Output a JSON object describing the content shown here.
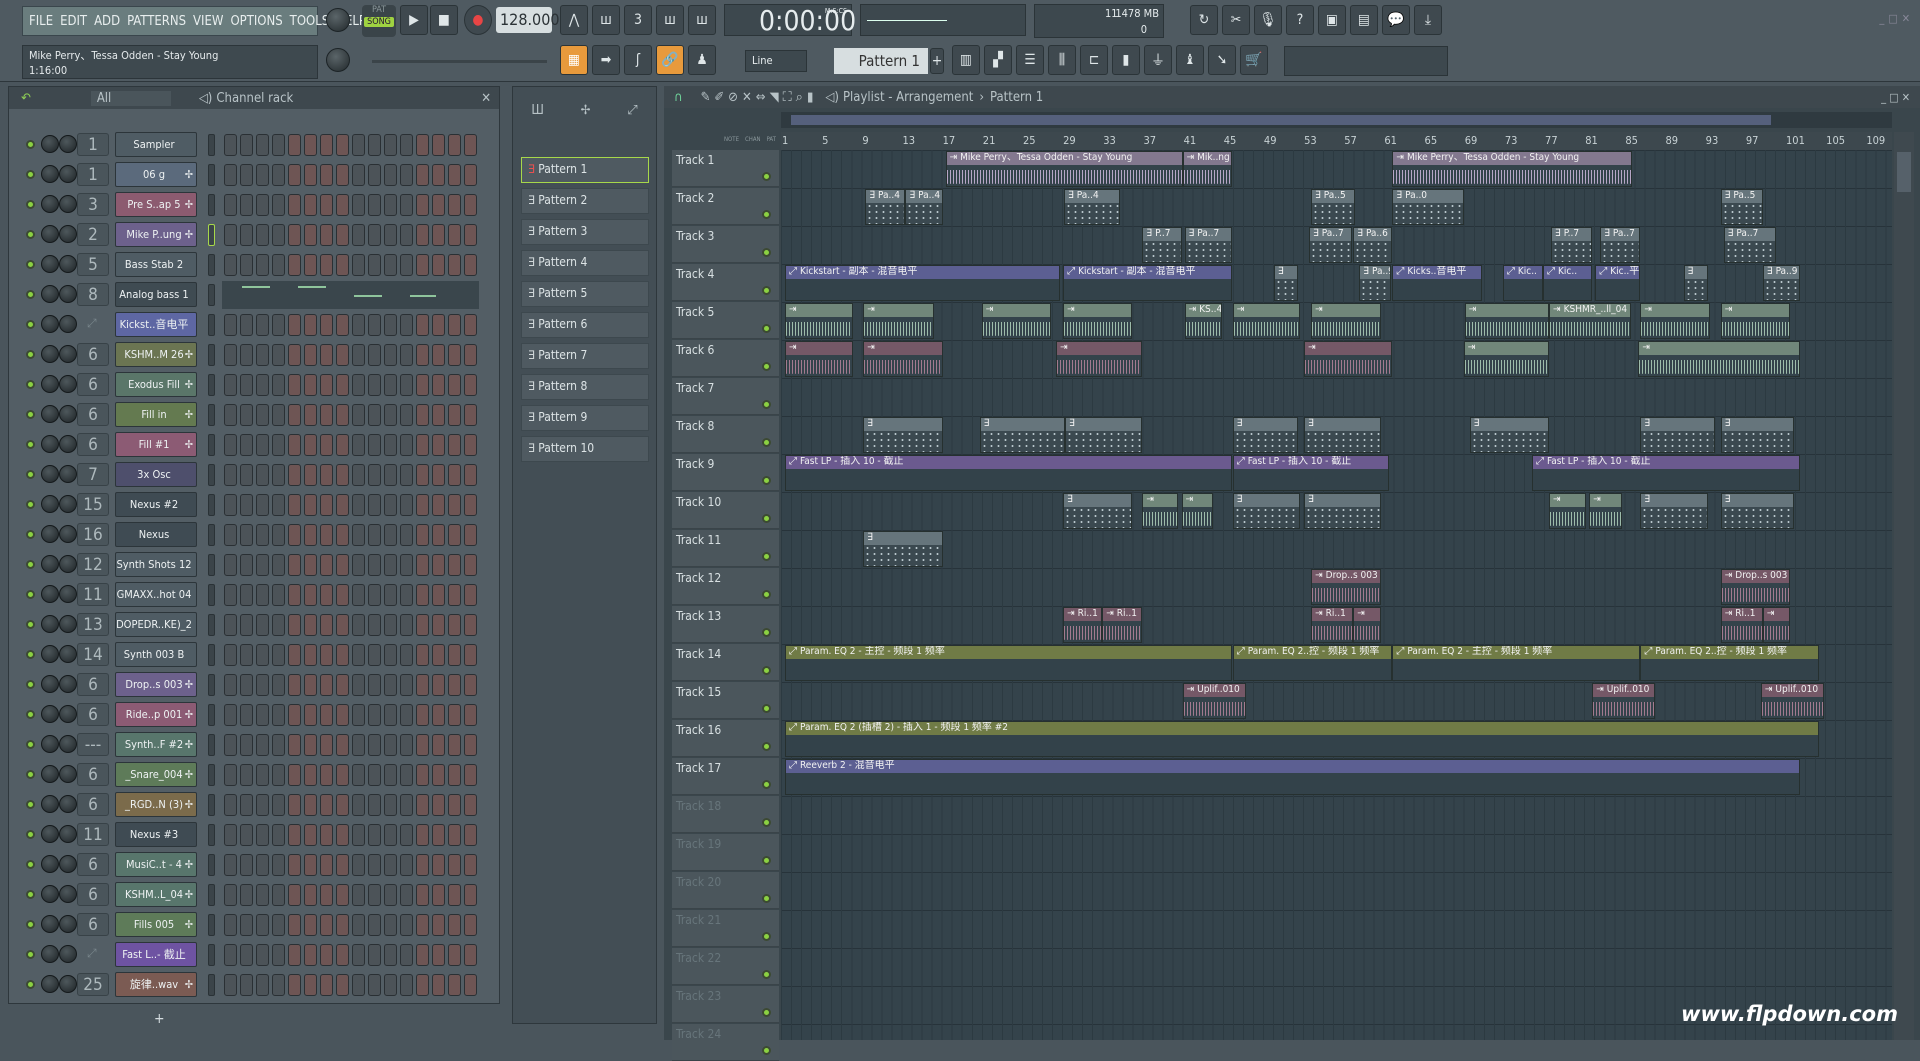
{
  "menu": [
    "FILE",
    "EDIT",
    "ADD",
    "PATTERNS",
    "VIEW",
    "OPTIONS",
    "TOOLS",
    "HELP"
  ],
  "transport": {
    "pat": "PAT",
    "song": "SONG",
    "tempo": "128.000",
    "time": "0:00:00",
    "time_unit": "M:S:CS",
    "cpu": "11",
    "memory": "1478 MB",
    "poly": "0"
  },
  "song": {
    "title": "Mike Perry、Tessa Odden - Stay Young",
    "length": "1:16:00"
  },
  "toolbar2": {
    "snap": "Line",
    "pattern": "Pattern 1",
    "add": "+"
  },
  "rack": {
    "filter": "All",
    "title": "Channel rack",
    "add": "+",
    "channels": [
      {
        "num": "1",
        "name": "Sampler",
        "color": "#4f5c64",
        "wave": false
      },
      {
        "num": "1",
        "name": "06 g",
        "color": "#5b6a7c",
        "wave": true
      },
      {
        "num": "3",
        "name": "Pre S..ap 5",
        "color": "#8c5b70",
        "wave": true
      },
      {
        "num": "2",
        "name": "Mike P..ung",
        "color": "#6d618c",
        "wave": true
      },
      {
        "num": "5",
        "name": "Bass Stab 2",
        "color": "#4f5c64",
        "wave": false
      },
      {
        "num": "8",
        "name": "Analog bass 1",
        "color": "#3f4b52",
        "wave": false,
        "pianoroll": true
      },
      {
        "num": "",
        "name": "Kickst..音电平",
        "color": "#5e67a3",
        "wave": false,
        "automation": true
      },
      {
        "num": "6",
        "name": "KSHM..M 26",
        "color": "#6b7552",
        "wave": true
      },
      {
        "num": "6",
        "name": "Exodus Fill",
        "color": "#5a7669",
        "wave": true
      },
      {
        "num": "6",
        "name": "Fill in",
        "color": "#647a50",
        "wave": true
      },
      {
        "num": "6",
        "name": "Fill #1",
        "color": "#8c5b74",
        "wave": true
      },
      {
        "num": "7",
        "name": "3x Osc",
        "color": "#4e4f6c",
        "wave": false
      },
      {
        "num": "15",
        "name": "Nexus #2",
        "color": "#3f4b53",
        "wave": false
      },
      {
        "num": "16",
        "name": "Nexus",
        "color": "#3f4b53",
        "wave": false
      },
      {
        "num": "12",
        "name": "Synth Shots 12",
        "color": "#4f5c64",
        "wave": false
      },
      {
        "num": "11",
        "name": "GMAXX..hot 04",
        "color": "#4f5c64",
        "wave": false
      },
      {
        "num": "13",
        "name": "DOPEDR..KE)_2",
        "color": "#4f5c64",
        "wave": false
      },
      {
        "num": "14",
        "name": "Synth 003 B",
        "color": "#4f5c64",
        "wave": false
      },
      {
        "num": "6",
        "name": "Drop..s 003",
        "color": "#6d618c",
        "wave": true
      },
      {
        "num": "6",
        "name": "Ride..p 001",
        "color": "#8c5b74",
        "wave": true
      },
      {
        "num": "---",
        "name": "Synth..F #2",
        "color": "#58766c",
        "wave": true
      },
      {
        "num": "6",
        "name": "_Snare_004",
        "color": "#5e7b59",
        "wave": true
      },
      {
        "num": "6",
        "name": "_RGD..N (3)",
        "color": "#7b6b4b",
        "wave": true
      },
      {
        "num": "11",
        "name": "Nexus #3",
        "color": "#3f4b53",
        "wave": false
      },
      {
        "num": "6",
        "name": "MusiC..t - 4",
        "color": "#58766c",
        "wave": true
      },
      {
        "num": "6",
        "name": "KSHM..L_04",
        "color": "#58766c",
        "wave": true
      },
      {
        "num": "6",
        "name": "Fills 005",
        "color": "#5e7b59",
        "wave": true
      },
      {
        "num": "",
        "name": "Fast L..- 截止",
        "color": "#6e53a2",
        "wave": false,
        "automation": true
      },
      {
        "num": "25",
        "name": "旋律..wav",
        "color": "#7b5b53",
        "wave": true
      }
    ]
  },
  "patterns": [
    "Pattern 1",
    "Pattern 2",
    "Pattern 3",
    "Pattern 4",
    "Pattern 5",
    "Pattern 6",
    "Pattern 7",
    "Pattern 8",
    "Pattern 9",
    "Pattern 10"
  ],
  "playlist": {
    "title": "Playlist - Arrangement",
    "crumb": "Pattern 1",
    "cols": [
      "NOTE",
      "CHAN",
      "PAT"
    ],
    "ruler": [
      "1",
      "5",
      "9",
      "13",
      "17",
      "21",
      "25",
      "29",
      "33",
      "37",
      "41",
      "45",
      "49",
      "53",
      "57",
      "61",
      "65",
      "69",
      "73",
      "77",
      "81",
      "85",
      "89",
      "93",
      "97",
      "101",
      "105",
      "109"
    ],
    "tracks": [
      "Track 1",
      "Track 2",
      "Track 3",
      "Track 4",
      "Track 5",
      "Track 6",
      "Track 7",
      "Track 8",
      "Track 9",
      "Track 10",
      "Track 11",
      "Track 12",
      "Track 13",
      "Track 14",
      "Track 15",
      "Track 16",
      "Track 17",
      "Track 18",
      "Track 19",
      "Track 20",
      "Track 21",
      "Track 22",
      "Track 23",
      "Track 24"
    ],
    "clip_colors": {
      "audio_purple": "#b6a6c6",
      "audio_green": "#9dbbaa",
      "pattern": "#5b6a72",
      "auto_blue": "#5c5f92",
      "auto_purple": "#6b5a8f",
      "auto_olive": "#707b46",
      "audio_pink": "#a27a8f"
    },
    "clips": [
      {
        "track": 1,
        "start": 17,
        "end": 40.6,
        "label": "Mike Perry、Tessa Odden - Stay Young",
        "kind": "audio_purple"
      },
      {
        "track": 1,
        "start": 40.6,
        "end": 45.5,
        "label": "Mik..ng",
        "kind": "audio_purple"
      },
      {
        "track": 1,
        "start": 61.5,
        "end": 85.4,
        "label": "Mike Perry、Tessa Odden - Stay Young",
        "kind": "audio_purple"
      },
      {
        "track": 2,
        "start": 9,
        "end": 13,
        "label": "Pa..4",
        "kind": "pattern"
      },
      {
        "track": 2,
        "start": 13,
        "end": 16.7,
        "label": "Pa..4",
        "kind": "pattern"
      },
      {
        "track": 2,
        "start": 28.8,
        "end": 34.4,
        "label": "Pa..4",
        "kind": "pattern"
      },
      {
        "track": 2,
        "start": 53.4,
        "end": 57.8,
        "label": "Pa..5",
        "kind": "pattern"
      },
      {
        "track": 2,
        "start": 61.5,
        "end": 68.6,
        "label": "Pa..0",
        "kind": "pattern"
      },
      {
        "track": 2,
        "start": 94.2,
        "end": 98.4,
        "label": "Pa..5",
        "kind": "pattern"
      },
      {
        "track": 3,
        "start": 36.6,
        "end": 40.5,
        "label": "P..7",
        "kind": "pattern"
      },
      {
        "track": 3,
        "start": 40.8,
        "end": 45.5,
        "label": "Pa..7",
        "kind": "pattern"
      },
      {
        "track": 3,
        "start": 53.2,
        "end": 57.5,
        "label": "Pa..7",
        "kind": "pattern"
      },
      {
        "track": 3,
        "start": 57.6,
        "end": 61.5,
        "label": "Pa..6",
        "kind": "pattern"
      },
      {
        "track": 3,
        "start": 77.3,
        "end": 81.4,
        "label": "P..7",
        "kind": "pattern"
      },
      {
        "track": 3,
        "start": 82.2,
        "end": 86.2,
        "label": "Pa..7",
        "kind": "pattern"
      },
      {
        "track": 3,
        "start": 94.5,
        "end": 99.7,
        "label": "Pa..7",
        "kind": "pattern"
      },
      {
        "track": 4,
        "start": 1,
        "end": 28.4,
        "label": "Kickstart - 副本 - 混音电平",
        "kind": "auto_blue"
      },
      {
        "track": 4,
        "start": 28.7,
        "end": 45.5,
        "label": "Kickstart - 副本 - 混音电平",
        "kind": "auto_blue"
      },
      {
        "track": 4,
        "start": 49.7,
        "end": 52.1,
        "label": "",
        "kind": "pattern"
      },
      {
        "track": 4,
        "start": 58.2,
        "end": 61.4,
        "label": "Pa..9",
        "kind": "pattern"
      },
      {
        "track": 4,
        "start": 61.5,
        "end": 70.4,
        "label": "Kicks..音电平",
        "kind": "auto_blue"
      },
      {
        "track": 4,
        "start": 72.5,
        "end": 76.5,
        "label": "Kic..",
        "kind": "auto_blue"
      },
      {
        "track": 4,
        "start": 76.5,
        "end": 81.4,
        "label": "Kic..",
        "kind": "auto_blue"
      },
      {
        "track": 4,
        "start": 81.7,
        "end": 86.2,
        "label": "Kic..平",
        "kind": "auto_blue"
      },
      {
        "track": 4,
        "start": 90.5,
        "end": 92.9,
        "label": "",
        "kind": "pattern"
      },
      {
        "track": 4,
        "start": 98.4,
        "end": 102.1,
        "label": "Pa..9",
        "kind": "pattern"
      },
      {
        "track": 5,
        "start": 1,
        "end": 7.8,
        "label": "",
        "kind": "audio_green"
      },
      {
        "track": 5,
        "start": 8.8,
        "end": 15.8,
        "label": "",
        "kind": "audio_green"
      },
      {
        "track": 5,
        "start": 20.6,
        "end": 27.5,
        "label": "",
        "kind": "audio_green"
      },
      {
        "track": 5,
        "start": 28.7,
        "end": 35.6,
        "label": "",
        "kind": "audio_green"
      },
      {
        "track": 5,
        "start": 40.8,
        "end": 44.5,
        "label": "KS..4",
        "kind": "audio_green"
      },
      {
        "track": 5,
        "start": 45.6,
        "end": 52.3,
        "label": "",
        "kind": "audio_green"
      },
      {
        "track": 5,
        "start": 53.4,
        "end": 60.4,
        "label": "",
        "kind": "audio_green"
      },
      {
        "track": 5,
        "start": 68.7,
        "end": 77.1,
        "label": "",
        "kind": "audio_green"
      },
      {
        "track": 5,
        "start": 77.1,
        "end": 85.3,
        "label": "KSHMR_..ll_04",
        "kind": "audio_green"
      },
      {
        "track": 5,
        "start": 86.2,
        "end": 93.1,
        "label": "",
        "kind": "audio_green"
      },
      {
        "track": 5,
        "start": 94.2,
        "end": 101.1,
        "label": "",
        "kind": "audio_green"
      },
      {
        "track": 6,
        "start": 1,
        "end": 7.8,
        "label": "",
        "kind": "audio_pink"
      },
      {
        "track": 6,
        "start": 8.8,
        "end": 16.7,
        "label": "",
        "kind": "audio_pink"
      },
      {
        "track": 6,
        "start": 28,
        "end": 36.6,
        "label": "",
        "kind": "audio_pink"
      },
      {
        "track": 6,
        "start": 52.7,
        "end": 61.5,
        "label": "",
        "kind": "audio_pink"
      },
      {
        "track": 6,
        "start": 68.6,
        "end": 77.1,
        "label": "",
        "kind": "audio_green"
      },
      {
        "track": 6,
        "start": 86,
        "end": 102.1,
        "label": "",
        "kind": "audio_green"
      },
      {
        "track": 8,
        "start": 8.8,
        "end": 16.7,
        "label": "",
        "kind": "pattern"
      },
      {
        "track": 8,
        "start": 20.4,
        "end": 28.9,
        "label": "",
        "kind": "pattern"
      },
      {
        "track": 8,
        "start": 28.9,
        "end": 36.6,
        "label": "",
        "kind": "pattern"
      },
      {
        "track": 8,
        "start": 45.6,
        "end": 52.1,
        "label": "",
        "kind": "pattern"
      },
      {
        "track": 8,
        "start": 52.7,
        "end": 60.4,
        "label": "",
        "kind": "pattern"
      },
      {
        "track": 8,
        "start": 69.2,
        "end": 77.1,
        "label": "",
        "kind": "pattern"
      },
      {
        "track": 8,
        "start": 86.2,
        "end": 93.6,
        "label": "",
        "kind": "pattern"
      },
      {
        "track": 8,
        "start": 94.2,
        "end": 101.5,
        "label": "",
        "kind": "pattern"
      },
      {
        "track": 9,
        "start": 1,
        "end": 45.5,
        "label": "Fast LP - 插入 10 - 截止",
        "kind": "auto_purple"
      },
      {
        "track": 9,
        "start": 45.6,
        "end": 61.2,
        "label": "Fast LP - 插入 10 - 截止",
        "kind": "auto_purple"
      },
      {
        "track": 9,
        "start": 75.4,
        "end": 102.1,
        "label": "Fast LP - 插入 10 - 截止",
        "kind": "auto_purple"
      },
      {
        "track": 10,
        "start": 28.7,
        "end": 35.6,
        "label": "",
        "kind": "pattern"
      },
      {
        "track": 10,
        "start": 36.6,
        "end": 40.1,
        "label": "",
        "kind": "audio_green"
      },
      {
        "track": 10,
        "start": 40.5,
        "end": 43.6,
        "label": "",
        "kind": "audio_green"
      },
      {
        "track": 10,
        "start": 45.6,
        "end": 52.3,
        "label": "",
        "kind": "pattern"
      },
      {
        "track": 10,
        "start": 52.7,
        "end": 60.4,
        "label": "",
        "kind": "pattern"
      },
      {
        "track": 10,
        "start": 77.1,
        "end": 80.8,
        "label": "",
        "kind": "audio_green"
      },
      {
        "track": 10,
        "start": 81.1,
        "end": 84.4,
        "label": "",
        "kind": "audio_green"
      },
      {
        "track": 10,
        "start": 86.2,
        "end": 92.9,
        "label": "",
        "kind": "pattern"
      },
      {
        "track": 10,
        "start": 94.2,
        "end": 101.5,
        "label": "",
        "kind": "pattern"
      },
      {
        "track": 11,
        "start": 8.8,
        "end": 16.7,
        "label": "",
        "kind": "pattern"
      },
      {
        "track": 12,
        "start": 53.4,
        "end": 60.4,
        "label": "Drop..s 003",
        "kind": "audio_pink"
      },
      {
        "track": 12,
        "start": 94.2,
        "end": 101.1,
        "label": "Drop..s 003",
        "kind": "audio_pink"
      },
      {
        "track": 13,
        "start": 28.7,
        "end": 32.6,
        "label": "Ri..1",
        "kind": "audio_pink"
      },
      {
        "track": 13,
        "start": 32.6,
        "end": 36.6,
        "label": "Ri..1",
        "kind": "audio_pink"
      },
      {
        "track": 13,
        "start": 53.4,
        "end": 57.6,
        "label": "Ri..1",
        "kind": "audio_pink"
      },
      {
        "track": 13,
        "start": 57.6,
        "end": 60.4,
        "label": "",
        "kind": "audio_pink"
      },
      {
        "track": 13,
        "start": 94.2,
        "end": 98.4,
        "label": "Ri..1",
        "kind": "audio_pink"
      },
      {
        "track": 13,
        "start": 98.4,
        "end": 101.1,
        "label": "",
        "kind": "audio_pink"
      },
      {
        "track": 14,
        "start": 1,
        "end": 45.5,
        "label": "Param. EQ 2 - 主控 - 频段 1 频率",
        "kind": "auto_olive"
      },
      {
        "track": 14,
        "start": 45.6,
        "end": 61.5,
        "label": "Param. EQ 2..控 - 频段 1 频率",
        "kind": "auto_olive"
      },
      {
        "track": 14,
        "start": 61.5,
        "end": 86.2,
        "label": "Param. EQ 2 - 主控 - 频段 1 频率",
        "kind": "auto_olive"
      },
      {
        "track": 14,
        "start": 86.2,
        "end": 104,
        "label": "Param. EQ 2..控 - 频段 1 频率",
        "kind": "auto_olive"
      },
      {
        "track": 15,
        "start": 40.6,
        "end": 46.9,
        "label": "Uplif..010",
        "kind": "audio_pink"
      },
      {
        "track": 15,
        "start": 81.4,
        "end": 87.7,
        "label": "Uplif..010",
        "kind": "audio_pink"
      },
      {
        "track": 15,
        "start": 98.2,
        "end": 104.5,
        "label": "Uplif..010",
        "kind": "audio_pink"
      },
      {
        "track": 16,
        "start": 1,
        "end": 104,
        "label": "Param. EQ 2 (插槽 2) - 插入 1 - 频段 1 频率 #2",
        "kind": "auto_olive"
      },
      {
        "track": 17,
        "start": 1,
        "end": 102.1,
        "label": "Reeverb 2 - 混音电平",
        "kind": "auto_blue"
      }
    ]
  },
  "watermark": "www.flpdown.com"
}
